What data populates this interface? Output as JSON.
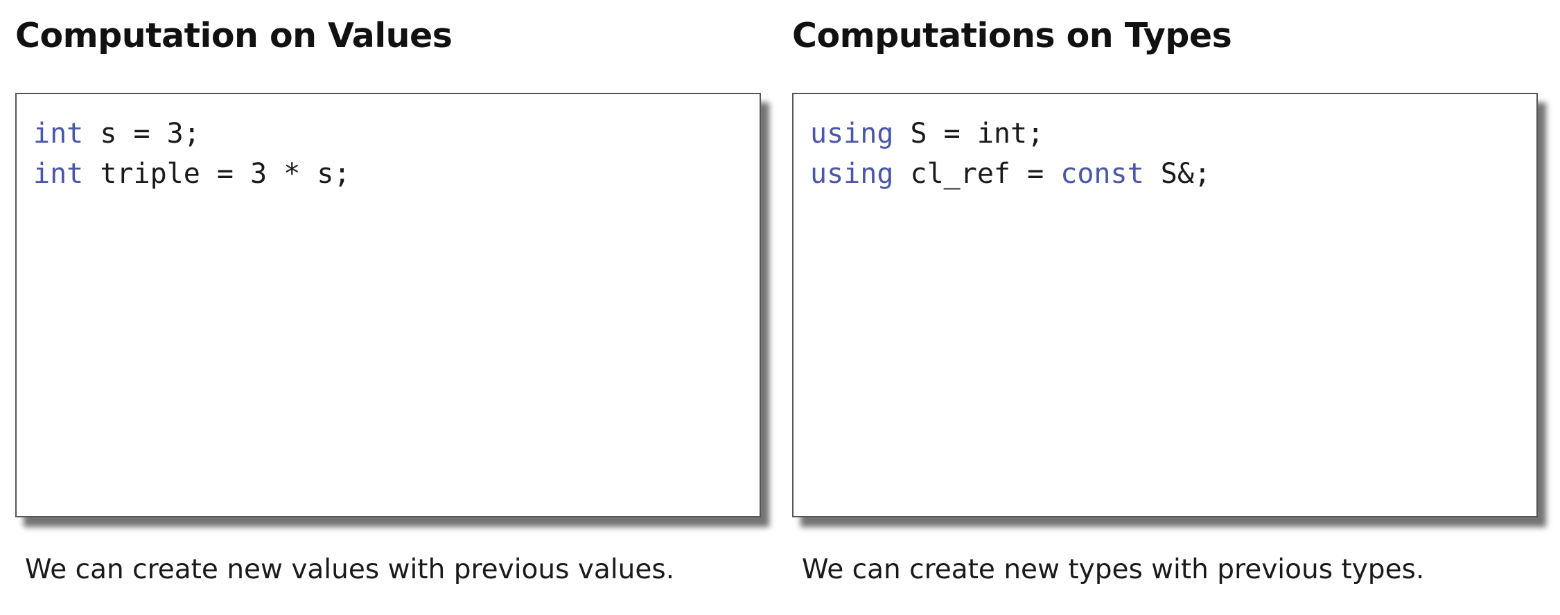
{
  "panels": [
    {
      "heading": "Computation on Values",
      "code_lines": [
        [
          {
            "text": "int",
            "keyword": true
          },
          {
            "text": " s = 3;",
            "keyword": false
          }
        ],
        [
          {
            "text": "int",
            "keyword": true
          },
          {
            "text": " triple = 3 * s;",
            "keyword": false
          }
        ]
      ],
      "caption": "We can create new values with previous values."
    },
    {
      "heading": "Computations on Types",
      "code_lines": [
        [
          {
            "text": "using",
            "keyword": true
          },
          {
            "text": " S = int;",
            "keyword": false
          }
        ],
        [
          {
            "text": "using",
            "keyword": true
          },
          {
            "text": " cl_ref = ",
            "keyword": false
          },
          {
            "text": "const",
            "keyword": true
          },
          {
            "text": " S&;",
            "keyword": false
          }
        ]
      ],
      "caption": "We can create new types with previous types."
    }
  ],
  "colors": {
    "keyword": "#4a56a6",
    "text": "#1a1a1a",
    "border": "#555555"
  }
}
